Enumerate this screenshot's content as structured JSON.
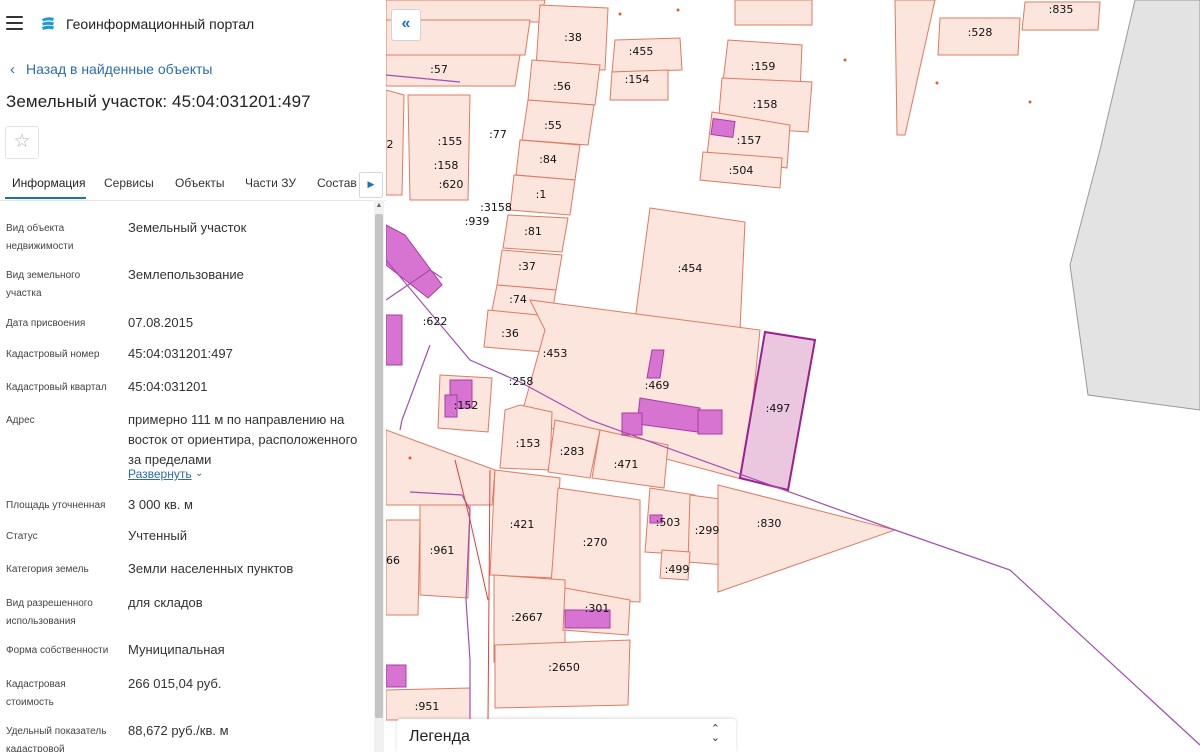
{
  "header": {
    "portal_title": "Геоинформационный портал"
  },
  "nav": {
    "back_label": "Назад в найденные объекты"
  },
  "object": {
    "title": "Земельный участок: 45:04:031201:497"
  },
  "tabs": [
    {
      "label": "Информация"
    },
    {
      "label": "Сервисы"
    },
    {
      "label": "Объекты"
    },
    {
      "label": "Части ЗУ"
    },
    {
      "label": "Состав"
    }
  ],
  "icons": {
    "menu": "hamburger-icon",
    "logo": "portal-logo-icon",
    "back": "chevron-left-icon",
    "favorite": "star-icon",
    "tabs_next": "chevron-right-icon",
    "collapse": "double-chevron-left-icon",
    "legend_toggle": "chevron-updown-icon"
  },
  "properties": [
    {
      "label": "Вид объекта недвижимости",
      "value": "Земельный участок"
    },
    {
      "label": "Вид земельного участка",
      "value": "Землепользование"
    },
    {
      "label": "Дата присвоения",
      "value": "07.08.2015"
    },
    {
      "label": "Кадастровый номер",
      "value": "45:04:031201:497"
    },
    {
      "label": "Кадастровый квартал",
      "value": "45:04:031201"
    },
    {
      "label": "Адрес",
      "value": "примерно 111 м по направлению на восток от ориентира, расположенного за пределами"
    },
    {
      "label": "Площадь уточненная",
      "value": "3 000 кв. м"
    },
    {
      "label": "Статус",
      "value": "Учтенный"
    },
    {
      "label": "Категория земель",
      "value": "Земли населенных пунктов"
    },
    {
      "label": "Вид разрешенного использования",
      "value": "для складов"
    },
    {
      "label": "Форма собственности",
      "value": "Муниципальная"
    },
    {
      "label": "Кадастровая стоимость",
      "value": "266 015,04 руб."
    },
    {
      "label": "Удельный показатель кадастровой",
      "value": "88,672 руб./кв. м"
    }
  ],
  "address_expand_label": "Развернуть",
  "map": {
    "parcel_labels": [
      ":835",
      ":528",
      ":38",
      ":455",
      ":154",
      ":159",
      ":57",
      ":56",
      ":158",
      ":55",
      ":157",
      ":155",
      ":77",
      ":84",
      ":504",
      ":158",
      ":620",
      ":1",
      ":3158",
      ":939",
      ":81",
      ":454",
      ":37",
      ":74",
      ":622",
      ":36",
      ":453",
      ":258",
      ":469",
      ":497",
      ":152",
      ":153",
      ":283",
      ":471",
      ":421",
      ":270",
      ":503",
      ":299",
      ":830",
      ":961",
      ":499",
      ":2667",
      ":301",
      ":2650",
      ":951",
      "2",
      "66"
    ],
    "colors": {
      "parcel_fill": "#fce5dc",
      "parcel_stroke": "#e07a62",
      "building_fill": "#d774d1",
      "selected_stroke": "#9a1f8f",
      "selected_fill": "#eac7df",
      "neighbor_fill": "#e3e3e3"
    }
  },
  "legend": {
    "title": "Легенда"
  }
}
